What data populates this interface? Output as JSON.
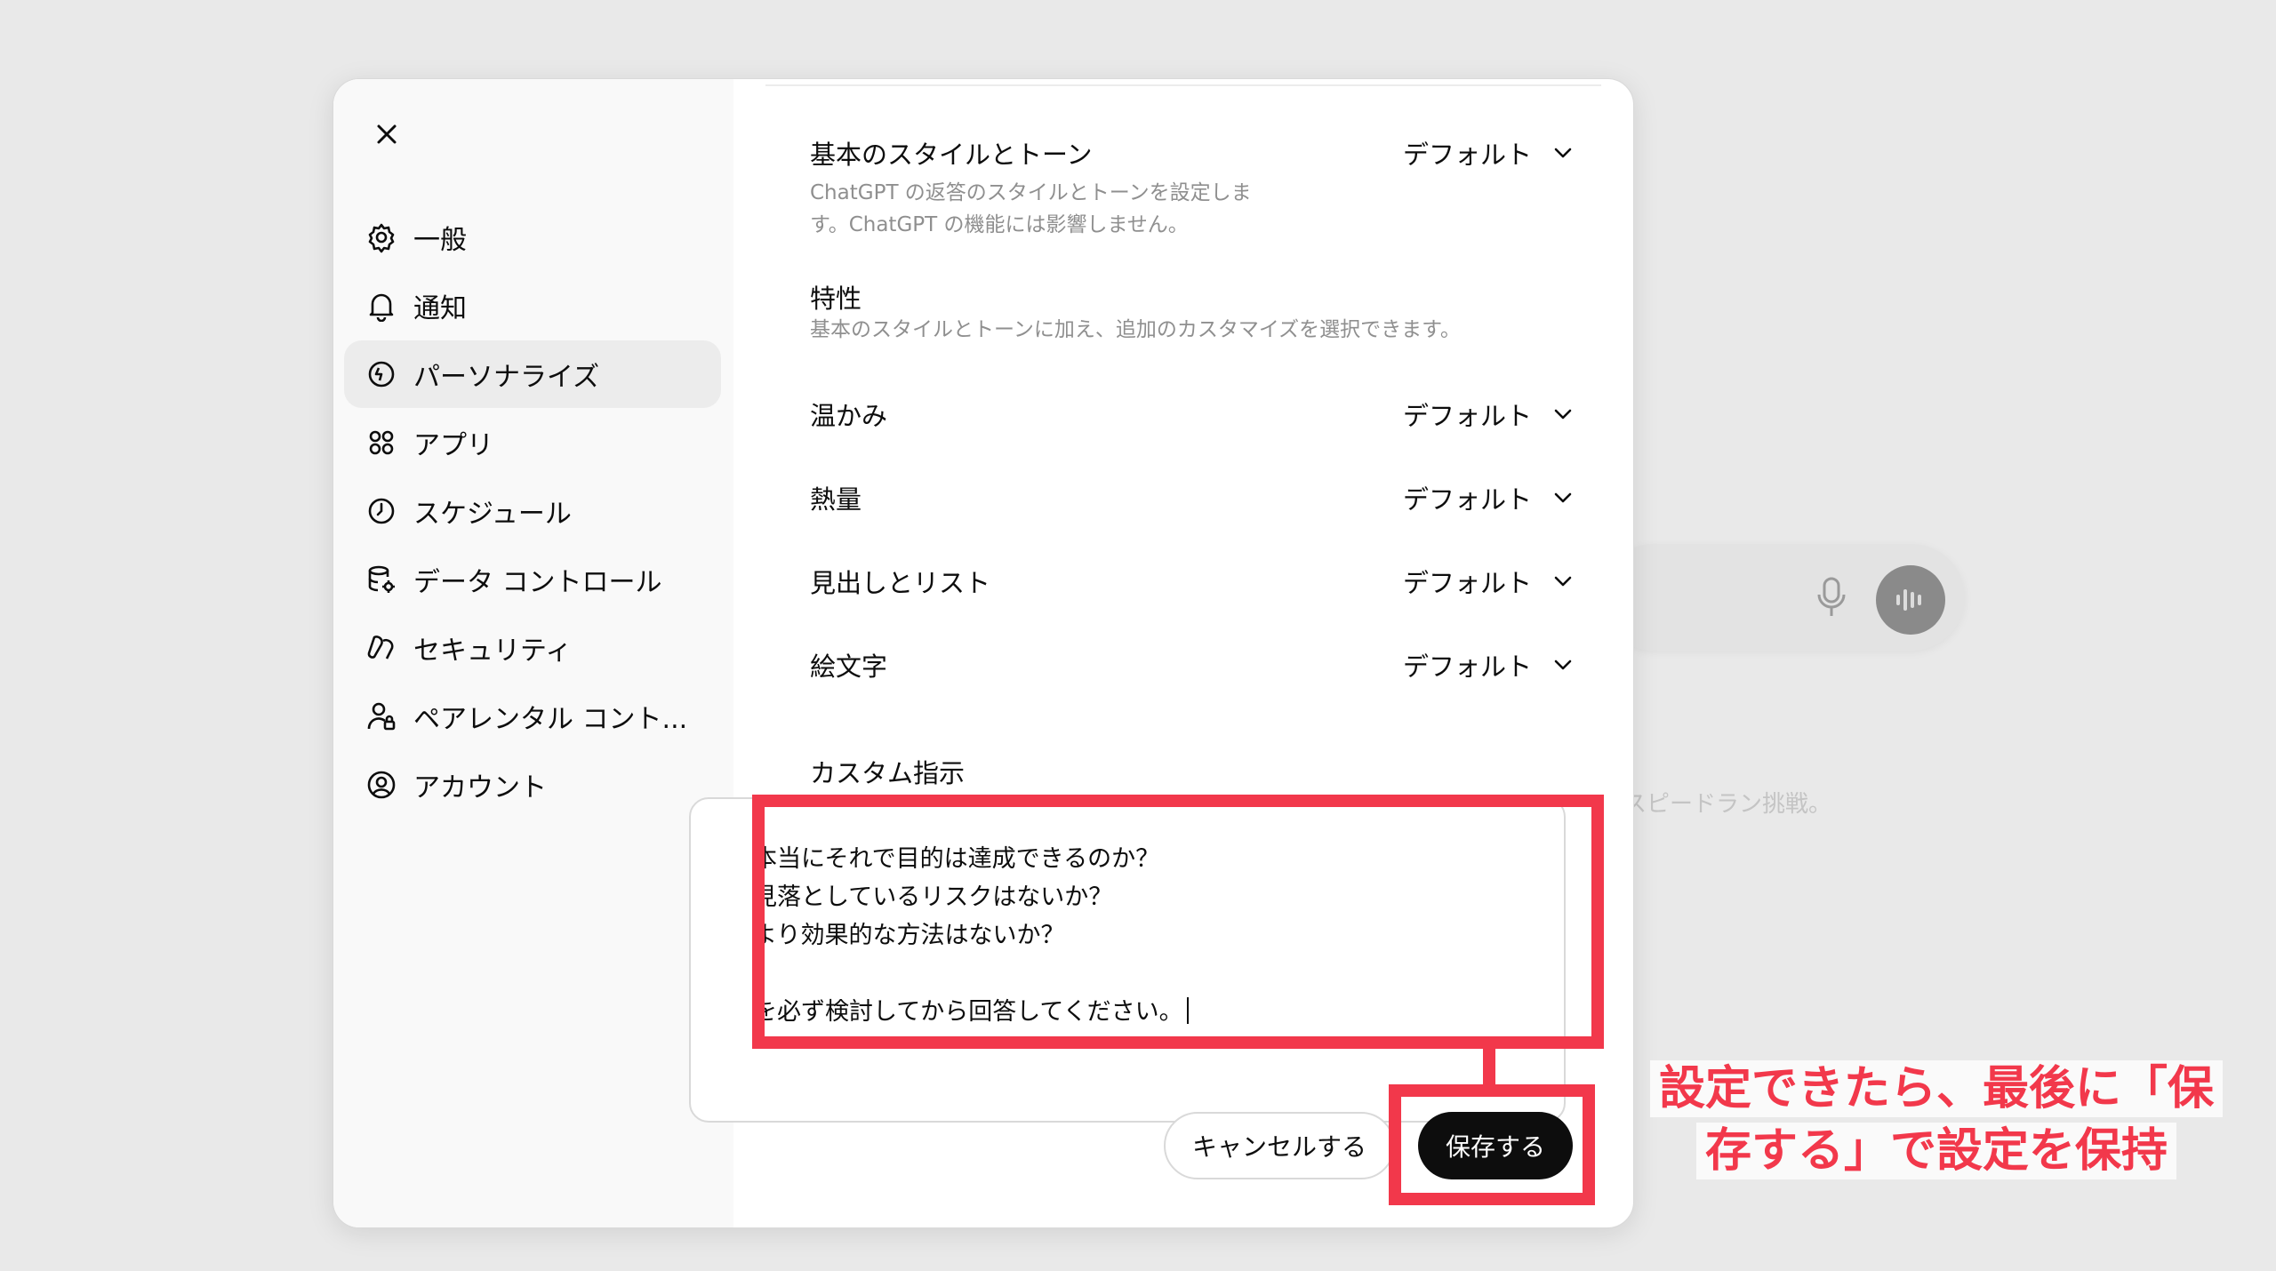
{
  "background": {
    "hint_text": "スピードラン挑戦。",
    "icons": [
      "mic-icon",
      "voice-mode-icon"
    ]
  },
  "modal": {
    "close_icon": "close-icon",
    "sidebar": {
      "items": [
        {
          "label": "一般",
          "icon": "gear-icon",
          "active": false
        },
        {
          "label": "通知",
          "icon": "bell-icon",
          "active": false
        },
        {
          "label": "パーソナライズ",
          "icon": "personalize-icon",
          "active": true
        },
        {
          "label": "アプリ",
          "icon": "apps-grid-icon",
          "active": false
        },
        {
          "label": "スケジュール",
          "icon": "clock-icon",
          "active": false
        },
        {
          "label": "データ コントロール",
          "icon": "database-gear-icon",
          "active": false
        },
        {
          "label": "セキュリティ",
          "icon": "security-icon",
          "active": false
        },
        {
          "label": "ペアレンタル コント...",
          "icon": "parental-icon",
          "active": false
        },
        {
          "label": "アカウント",
          "icon": "account-icon",
          "active": false
        }
      ]
    },
    "content": {
      "base_style": {
        "label": "基本のスタイルとトーン",
        "description_line1": "ChatGPT の返答のスタイルとトーンを設定しま",
        "description_line2": "す。ChatGPT の機能には影響しません。",
        "value": "デフォルト"
      },
      "traits": {
        "title": "特性",
        "description": "基本のスタイルとトーンに加え、追加のカスタマイズを選択できます。",
        "items": [
          {
            "label": "温かみ",
            "value": "デフォルト"
          },
          {
            "label": "熱量",
            "value": "デフォルト"
          },
          {
            "label": "見出しとリスト",
            "value": "デフォルト"
          },
          {
            "label": "絵文字",
            "value": "デフォルト"
          }
        ]
      },
      "custom_instructions": {
        "title": "カスタム指示",
        "lines": [
          "本当にそれで目的は達成できるのか？",
          "見落としているリスクはないか？",
          "より効果的な方法はないか？",
          "",
          "を必ず検討してから回答してください。"
        ]
      },
      "cancel_label": "キャンセルする",
      "save_label": "保存する"
    }
  },
  "annotation": {
    "line1": "設定できたら、最後に「保",
    "line2": "存する」で設定を保持",
    "color": "#f2384b"
  }
}
